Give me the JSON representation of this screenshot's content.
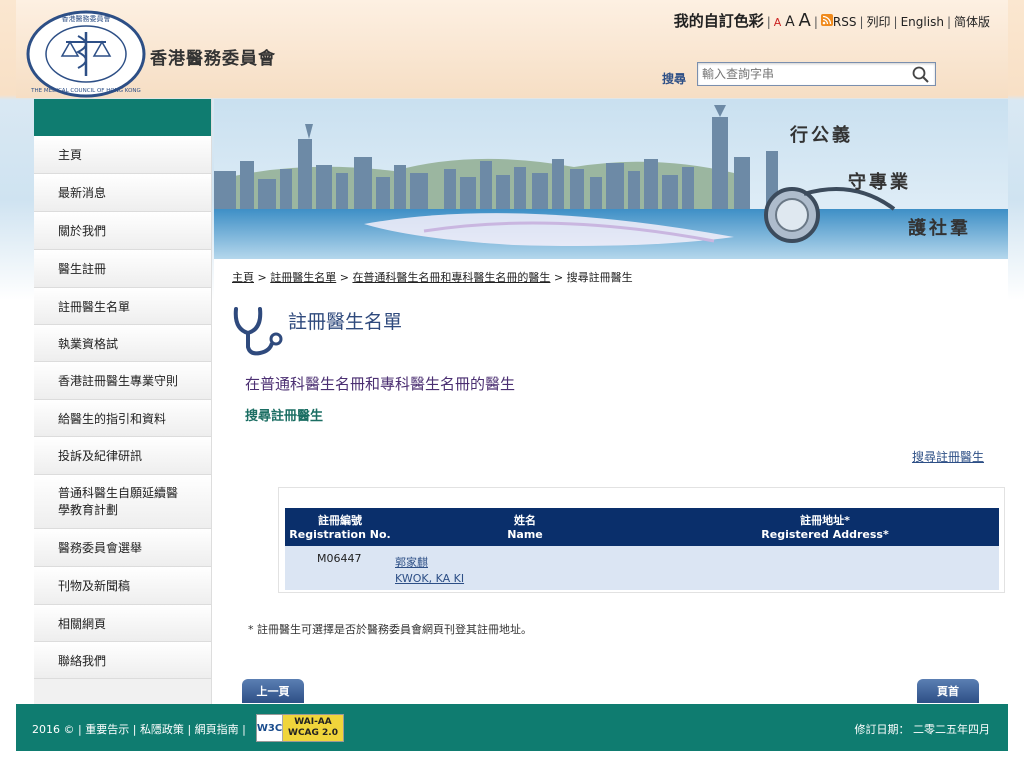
{
  "header": {
    "logo_ring_text": "香港醫務委員會 THE MEDICAL COUNCIL OF HONG KONG",
    "site_title": "香港醫務委員會",
    "color_label": "我的自訂色彩",
    "font_sizes": [
      "A",
      "A",
      "A"
    ],
    "rss": "RSS",
    "print": "列印",
    "english": "English",
    "simplified": "简体版",
    "search_label": "搜尋",
    "search_placeholder": "輸入查詢字串"
  },
  "banner": {
    "slogan": [
      "行公義",
      "守專業",
      "護社羣"
    ]
  },
  "sidebar": {
    "items": [
      {
        "label": "主頁"
      },
      {
        "label": "最新消息"
      },
      {
        "label": "關於我們"
      },
      {
        "label": "醫生註冊"
      },
      {
        "label": "註冊醫生名單"
      },
      {
        "label": "執業資格試"
      },
      {
        "label": "香港註冊醫生專業守則"
      },
      {
        "label": "給醫生的指引和資料"
      },
      {
        "label": "投訴及紀律研訊"
      },
      {
        "label": "普通科醫生自願延續醫學教育計劃"
      },
      {
        "label": "醫務委員會選舉"
      },
      {
        "label": "刊物及新聞稿"
      },
      {
        "label": "相關網頁"
      },
      {
        "label": "聯絡我們"
      }
    ]
  },
  "breadcrumb": {
    "home": "主頁",
    "list": "註冊醫生名單",
    "register": "在普通科醫生名冊和專科醫生名冊的醫生",
    "current": "搜尋註冊醫生",
    "sep": ">"
  },
  "main": {
    "page_title": "註冊醫生名單",
    "section_title": "在普通科醫生名冊和專科醫生名冊的醫生",
    "sub_title": "搜尋註冊醫生",
    "search_link": "搜尋註冊醫生",
    "table": {
      "headers": {
        "reg_zh": "註冊編號",
        "reg_en": "Registration No.",
        "name_zh": "姓名",
        "name_en": "Name",
        "addr_zh": "註冊地址*",
        "addr_en": "Registered Address*"
      },
      "rows": [
        {
          "reg_no": "M06447",
          "name_zh": "郭家麒",
          "name_en": "KWOK, KA KI",
          "address": ""
        }
      ]
    },
    "note": "* 註冊醫生可選擇是否於醫務委員會網頁刊登其註冊地址。",
    "prev_button": "上一頁",
    "top_button": "頁首"
  },
  "footer": {
    "copyright": "2016 ©",
    "important": "重要告示",
    "privacy": "私隱政策",
    "guide": "網頁指南",
    "badge_w3c": "W3C",
    "badge_level": "WAI-AA",
    "badge_wcag": "WCAG 2.0",
    "revised": "修訂日期： 二零二五年四月"
  },
  "colors": {
    "teal": "#0f7c70",
    "navy": "#0a2f6b",
    "title_blue": "#2f4a7d",
    "section_purple": "#4b2f72"
  }
}
